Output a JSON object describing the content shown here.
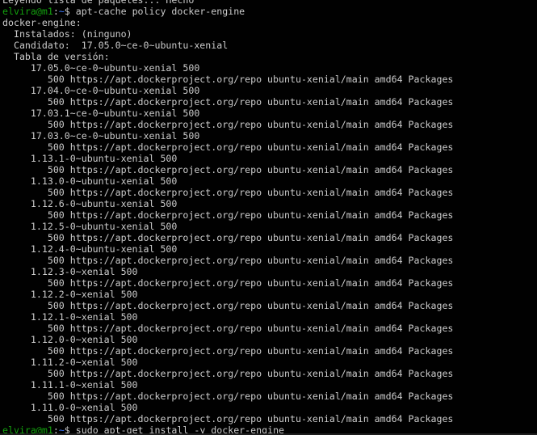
{
  "terminal": {
    "colors": {
      "background": "#010101",
      "foreground": "#cccccc",
      "prompt_user": "#13a10e",
      "prompt_path": "#3b78ff"
    },
    "lines": [
      {
        "type": "text",
        "text": "Leyendo lista de paquetes... Hecho"
      },
      {
        "type": "prompt",
        "user": "elvira@m1",
        "sep": ":",
        "path": "~",
        "symbol": "$ ",
        "cmd": "apt-cache policy docker-engine"
      },
      {
        "type": "text",
        "text": "docker-engine:"
      },
      {
        "type": "text",
        "text": "  Instalados: (ninguno)"
      },
      {
        "type": "text",
        "text": "  Candidato:  17.05.0~ce-0~ubuntu-xenial"
      },
      {
        "type": "text",
        "text": "  Tabla de versión:"
      },
      {
        "type": "text",
        "text": "     17.05.0~ce-0~ubuntu-xenial 500"
      },
      {
        "type": "text",
        "text": "        500 https://apt.dockerproject.org/repo ubuntu-xenial/main amd64 Packages"
      },
      {
        "type": "text",
        "text": "     17.04.0~ce-0~ubuntu-xenial 500"
      },
      {
        "type": "text",
        "text": "        500 https://apt.dockerproject.org/repo ubuntu-xenial/main amd64 Packages"
      },
      {
        "type": "text",
        "text": "     17.03.1~ce-0~ubuntu-xenial 500"
      },
      {
        "type": "text",
        "text": "        500 https://apt.dockerproject.org/repo ubuntu-xenial/main amd64 Packages"
      },
      {
        "type": "text",
        "text": "     17.03.0~ce-0~ubuntu-xenial 500"
      },
      {
        "type": "text",
        "text": "        500 https://apt.dockerproject.org/repo ubuntu-xenial/main amd64 Packages"
      },
      {
        "type": "text",
        "text": "     1.13.1-0~ubuntu-xenial 500"
      },
      {
        "type": "text",
        "text": "        500 https://apt.dockerproject.org/repo ubuntu-xenial/main amd64 Packages"
      },
      {
        "type": "text",
        "text": "     1.13.0-0~ubuntu-xenial 500"
      },
      {
        "type": "text",
        "text": "        500 https://apt.dockerproject.org/repo ubuntu-xenial/main amd64 Packages"
      },
      {
        "type": "text",
        "text": "     1.12.6-0~ubuntu-xenial 500"
      },
      {
        "type": "text",
        "text": "        500 https://apt.dockerproject.org/repo ubuntu-xenial/main amd64 Packages"
      },
      {
        "type": "text",
        "text": "     1.12.5-0~ubuntu-xenial 500"
      },
      {
        "type": "text",
        "text": "        500 https://apt.dockerproject.org/repo ubuntu-xenial/main amd64 Packages"
      },
      {
        "type": "text",
        "text": "     1.12.4-0~ubuntu-xenial 500"
      },
      {
        "type": "text",
        "text": "        500 https://apt.dockerproject.org/repo ubuntu-xenial/main amd64 Packages"
      },
      {
        "type": "text",
        "text": "     1.12.3-0~xenial 500"
      },
      {
        "type": "text",
        "text": "        500 https://apt.dockerproject.org/repo ubuntu-xenial/main amd64 Packages"
      },
      {
        "type": "text",
        "text": "     1.12.2-0~xenial 500"
      },
      {
        "type": "text",
        "text": "        500 https://apt.dockerproject.org/repo ubuntu-xenial/main amd64 Packages"
      },
      {
        "type": "text",
        "text": "     1.12.1-0~xenial 500"
      },
      {
        "type": "text",
        "text": "        500 https://apt.dockerproject.org/repo ubuntu-xenial/main amd64 Packages"
      },
      {
        "type": "text",
        "text": "     1.12.0-0~xenial 500"
      },
      {
        "type": "text",
        "text": "        500 https://apt.dockerproject.org/repo ubuntu-xenial/main amd64 Packages"
      },
      {
        "type": "text",
        "text": "     1.11.2-0~xenial 500"
      },
      {
        "type": "text",
        "text": "        500 https://apt.dockerproject.org/repo ubuntu-xenial/main amd64 Packages"
      },
      {
        "type": "text",
        "text": "     1.11.1-0~xenial 500"
      },
      {
        "type": "text",
        "text": "        500 https://apt.dockerproject.org/repo ubuntu-xenial/main amd64 Packages"
      },
      {
        "type": "text",
        "text": "     1.11.0-0~xenial 500"
      },
      {
        "type": "text",
        "text": "        500 https://apt.dockerproject.org/repo ubuntu-xenial/main amd64 Packages"
      },
      {
        "type": "prompt",
        "user": "elvira@m1",
        "sep": ":",
        "path": "~",
        "symbol": "$ ",
        "cmd": "sudo apt-get install -y docker-engine"
      }
    ]
  }
}
